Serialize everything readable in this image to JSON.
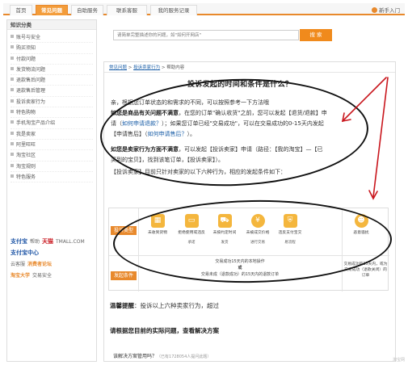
{
  "topnav": {
    "tabs": [
      {
        "label": "首页"
      },
      {
        "label": "常见问题"
      },
      {
        "label": "自助服务"
      },
      {
        "label": "联系客服"
      },
      {
        "label": "我的服务记录"
      }
    ],
    "help_entry": "新手入门"
  },
  "sidebar": {
    "heading": "知识分类",
    "items": [
      {
        "label": "账号与安全"
      },
      {
        "label": "购买须知"
      },
      {
        "label": "付款问题"
      },
      {
        "label": "发货物流问题"
      },
      {
        "label": "退款售后问题"
      },
      {
        "label": "退款售后管理"
      },
      {
        "label": "投诉卖家行为"
      },
      {
        "label": "特色购物"
      },
      {
        "label": "手机淘宝产品介绍"
      },
      {
        "label": "我是卖家"
      },
      {
        "label": "阿里旺旺"
      },
      {
        "label": "淘宝社区"
      },
      {
        "label": "淘宝规则"
      },
      {
        "label": "特色服务"
      }
    ],
    "logos": {
      "row1_a": "支付宝",
      "row1_b": "帮助",
      "row1_c": "天猫",
      "row1_d": "TMALL.COM",
      "row2_a": "支付宝中心",
      "row3_a": "云客服",
      "row3_b": "消费者论坛",
      "row4_a": "淘宝大学",
      "row4_b": "交易安全"
    }
  },
  "search": {
    "placeholder": "请简单完整描述你的问题，如\"如何开网店\"",
    "button_label": "搜 索"
  },
  "breadcrumb": {
    "crumb1": "常见问题",
    "sep": " > ",
    "crumb2": "投诉卖家行为",
    "crumb3": "帮助内容"
  },
  "article": {
    "title": "投诉发起的时间和条件是什么？",
    "p1": "亲，根据您订单状态的和需求的不同，可以按照参考一下方法哦",
    "p2_bold": "如您是商品有关问题不满意",
    "p2_rest": "，在您的订单\"确认收货\"之前，您可以发起【退货/退款】申",
    "p3_a": "请（",
    "p3_link1": "如何申请退款？",
    "p3_b": "）；如果您订单已经\"交易成功\"，可以在交易成功的0-15天内发起",
    "p4_a": "【申请售后】（",
    "p4_link2": "如何申请售后？",
    "p4_b": "）。",
    "p5_bold": "如您是卖家行为方面不满意",
    "p5_rest": "，可以发起【投诉卖家】申请（路径：【我的淘宝】—【已",
    "p6": "买到的宝贝】，找到该笔订单，【投诉卖家】）。",
    "p7": "【投诉卖家】目前只针对卖家的以下六种行为，相应的发起条件如下："
  },
  "table": {
    "row1_label": "投诉类型",
    "row2_label": "发起条件",
    "items": [
      {
        "icon": "calendar-icon",
        "glyph": "▦",
        "label": "未收到货物"
      },
      {
        "icon": "card-icon",
        "glyph": "▭",
        "label": "拒绝使用或违反",
        "label2": "承诺"
      },
      {
        "icon": "truck-icon",
        "glyph": "⛟",
        "label": "未按约定时间",
        "label2": "发货"
      },
      {
        "icon": "yen-icon",
        "glyph": "¥",
        "label": "未被成交价格",
        "label2": "进行交易"
      },
      {
        "icon": "shield-icon",
        "glyph": "⛨",
        "label": "违反支付宝交",
        "label2": "易流程"
      },
      {
        "icon": "user-icon",
        "glyph": "☻",
        "label": "恶意骚扰"
      }
    ],
    "timeline_line1": "交易成功15天内的本地操作",
    "timeline_or": "或",
    "timeline_line2": "交易未成（退款成功）的15天内的退款订单",
    "right_note": "交易成功的15天内，或为交易成功（退款关闭）的订单"
  },
  "tip": {
    "label": "温馨提醒",
    "text": "：投诉以上六种卖家行为，超过"
  },
  "choose_text": "请根据您目前的实际问题，查看解决方案",
  "resolve": {
    "question": "该解决方案管用吗？",
    "count": "（已有1728054人提问此题）"
  },
  "watermark": "淘宝网"
}
